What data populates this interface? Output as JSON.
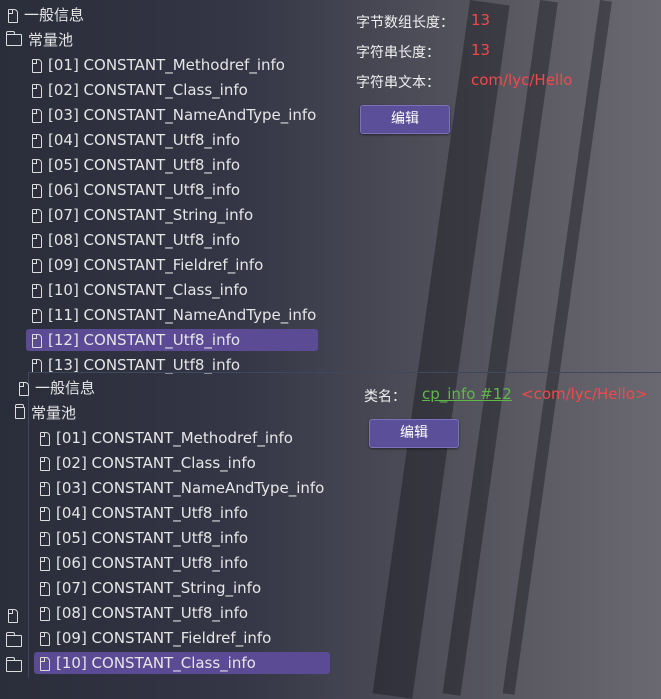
{
  "top": {
    "tree": {
      "general": "一般信息",
      "pool": "常量池",
      "items": [
        "[01] CONSTANT_Methodref_info",
        "[02] CONSTANT_Class_info",
        "[03] CONSTANT_NameAndType_info",
        "[04] CONSTANT_Utf8_info",
        "[05] CONSTANT_Utf8_info",
        "[06] CONSTANT_Utf8_info",
        "[07] CONSTANT_String_info",
        "[08] CONSTANT_Utf8_info",
        "[09] CONSTANT_Fieldref_info",
        "[10] CONSTANT_Class_info",
        "[11] CONSTANT_NameAndType_info",
        "[12] CONSTANT_Utf8_info",
        "[13] CONSTANT_Utf8_info"
      ],
      "selected_index": 11
    },
    "detail": {
      "byte_len_label": "字节数组长度：",
      "byte_len_value": "13",
      "str_len_label": "字符串长度：",
      "str_len_value": "13",
      "text_label": "字符串文本：",
      "text_value": "com/lyc/Hello",
      "edit_label": "编辑"
    }
  },
  "bottom": {
    "tree": {
      "general": "一般信息",
      "pool": "常量池",
      "items": [
        "[01] CONSTANT_Methodref_info",
        "[02] CONSTANT_Class_info",
        "[03] CONSTANT_NameAndType_info",
        "[04] CONSTANT_Utf8_info",
        "[05] CONSTANT_Utf8_info",
        "[06] CONSTANT_Utf8_info",
        "[07] CONSTANT_String_info",
        "[08] CONSTANT_Utf8_info",
        "[09] CONSTANT_Fieldref_info",
        "[10] CONSTANT_Class_info"
      ],
      "selected_index": 9
    },
    "detail": {
      "class_label": "类名：",
      "class_link": "cp_info #12",
      "class_value": "<com/lyc/Hello>",
      "edit_label": "编辑"
    }
  },
  "colors": {
    "selection": "#5b4b94",
    "value_red": "#ef4a4a",
    "link_green": "#5fb84a",
    "button": "#5a4f98"
  }
}
